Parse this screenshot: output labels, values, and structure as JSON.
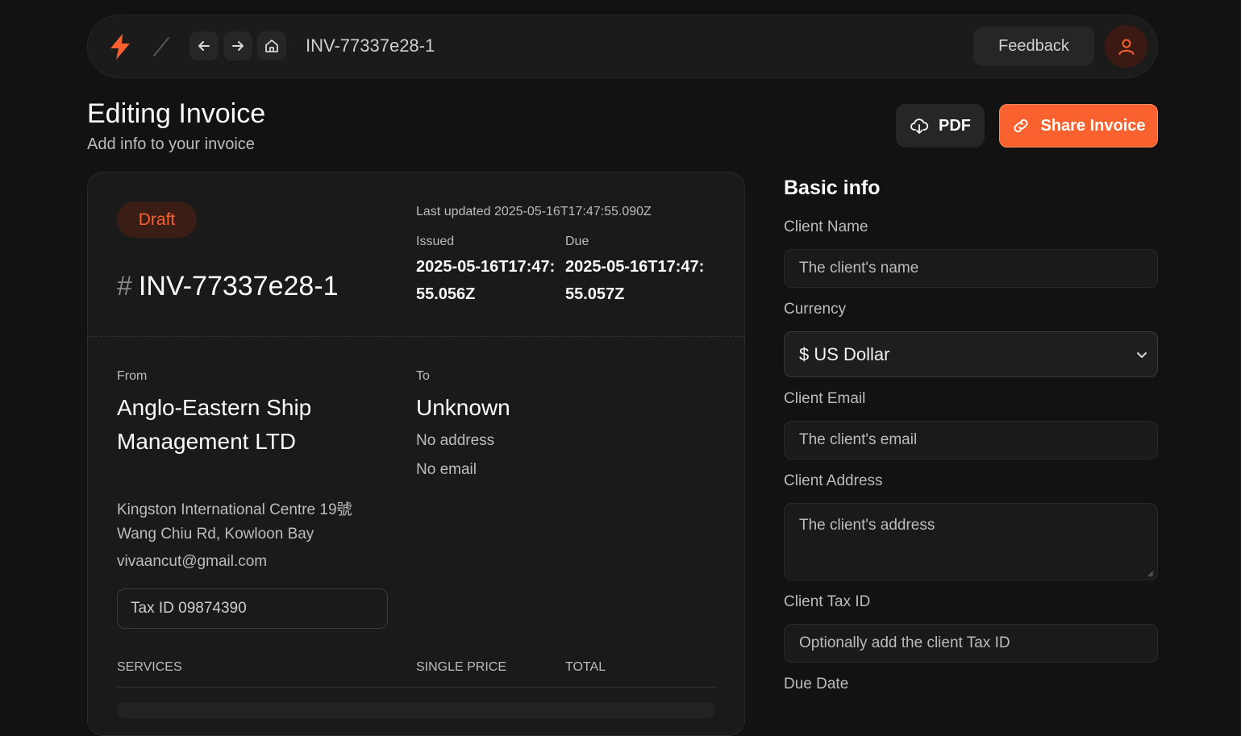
{
  "topbar": {
    "breadcrumb": "INV-77337e28-1",
    "feedback_label": "Feedback",
    "icons": [
      "bolt-icon",
      "slash-icon",
      "arrow-left-icon",
      "arrow-right-icon",
      "home-icon",
      "user-icon"
    ]
  },
  "header": {
    "title": "Editing Invoice",
    "subtitle": "Add info to your invoice",
    "pdf_label": "PDF",
    "share_label": "Share Invoice"
  },
  "invoice": {
    "status": "Draft",
    "hash": "#",
    "number": "INV-77337e28-1",
    "last_updated": "Last updated 2025-05-16T17:47:55.090Z",
    "issued_label": "Issued",
    "issued_value": "2025-05-16T17:47:55.056Z",
    "due_label": "Due",
    "due_value": "2025-05-16T17:47:55.057Z",
    "from": {
      "label": "From",
      "name": "Anglo-Eastern Ship Management LTD",
      "address": "Kingston International Centre 19號 Wang Chiu Rd, Kowloon Bay",
      "email": "vivaancut@gmail.com",
      "tax_id": "Tax ID 09874390"
    },
    "to": {
      "label": "To",
      "name": "Unknown",
      "address": "No address",
      "email": "No email"
    },
    "columns": [
      "SERVICES",
      "SINGLE PRICE",
      "TOTAL"
    ]
  },
  "basic_info": {
    "title": "Basic info",
    "client_name_label": "Client Name",
    "client_name_placeholder": "The client's name",
    "currency_label": "Currency",
    "currency_value": "$ US Dollar",
    "client_email_label": "Client Email",
    "client_email_placeholder": "The client's email",
    "client_address_label": "Client Address",
    "client_address_placeholder": "The client's address",
    "client_tax_label": "Client Tax ID",
    "client_tax_placeholder": "Optionally add the client Tax ID",
    "due_date_label": "Due Date"
  },
  "colors": {
    "accent": "#f9622e",
    "background": "#121212",
    "surface": "#1a1a1a"
  }
}
